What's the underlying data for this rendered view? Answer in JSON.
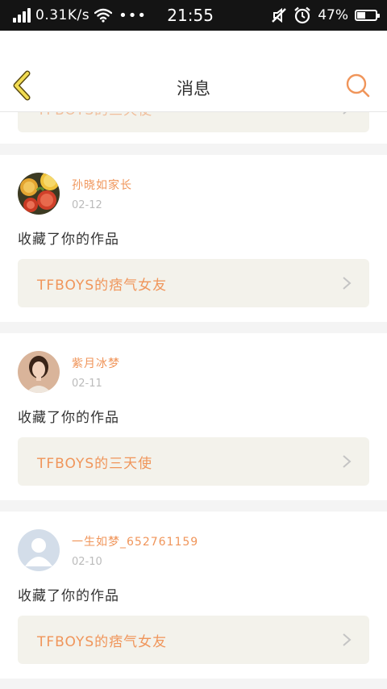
{
  "status_bar": {
    "network_speed": "0.31K/s",
    "dots": "•••",
    "time": "21:55",
    "battery_text": "47%",
    "battery_level": 0.47,
    "icons": [
      "signal-icon",
      "wifi-icon",
      "mute-icon",
      "alarm-icon",
      "battery-icon"
    ]
  },
  "header": {
    "title": "消息",
    "back_icon": "chevron-left-icon",
    "search_icon": "search-icon"
  },
  "colors": {
    "accent": "#f0955a",
    "back_icon": "#e6d04a",
    "work_box_bg": "#f3f2eb"
  },
  "partial_item": {
    "work_title": "TFBOYS的三天使"
  },
  "items": [
    {
      "username": "孙晓如家长",
      "date": "02-12",
      "action": "收藏了你的作品",
      "work_title": "TFBOYS的痞气女友",
      "avatar": "fruit-photo"
    },
    {
      "username": "紫月冰梦",
      "date": "02-11",
      "action": "收藏了你的作品",
      "work_title": "TFBOYS的三天使",
      "avatar": "portrait-photo"
    },
    {
      "username": "一生如梦_652761159",
      "date": "02-10",
      "action": "收藏了你的作品",
      "work_title": "TFBOYS的痞气女友",
      "avatar": "default-avatar"
    }
  ]
}
